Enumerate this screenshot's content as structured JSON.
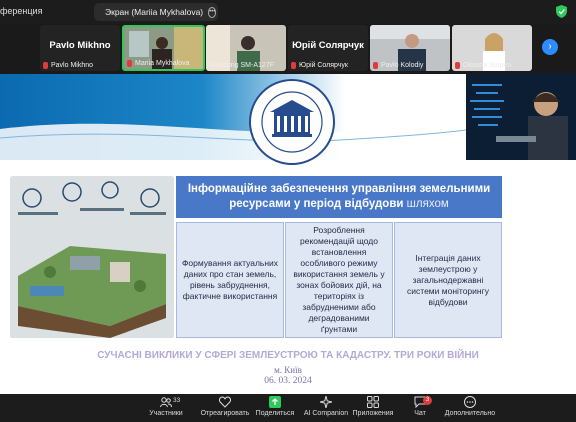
{
  "topbar": {
    "app_title": "ференция",
    "share_label": "Экран (Mariia Mykhalova)"
  },
  "gallery": {
    "tiles": [
      {
        "big_name": "Pavlo Mikhno",
        "caption": "Pavlo Mikhno"
      },
      {
        "big_name": "",
        "caption": "Mariia Mykhalova"
      },
      {
        "big_name": "",
        "caption": "Samsung SM-A127F"
      },
      {
        "big_name": "Юрій Солярчук",
        "caption": "Юрій Солярчук"
      },
      {
        "big_name": "",
        "caption": "Pavlo Kolodiy"
      },
      {
        "big_name": "",
        "caption": "Oksana Stupen"
      }
    ],
    "next_icon": "chevron-right-icon"
  },
  "slide": {
    "title_main": "Інформаційне забезпечення управління земельними ресурсами у період відбудови",
    "title_tail": "шляхом",
    "cells": [
      "Формування актуальних даних про стан земель, рівень забруднення, фактичне використання",
      "Розроблення рекомендацій щодо встановлення особливого режиму використання земель у зонах бойових дій, на територіях із забрудненими або деградованими ґрунтами",
      "Інтеграція даних землеустрою у загальнодержавні системи моніторингу відбудови"
    ],
    "bottom_line": "СУЧАСНІ ВИКЛИКИ У СФЕРІ ЗЕМЛЕУСТРОЮ ТА КАДАСТРУ. ТРИ РОКИ ВІЙНИ",
    "city": "м. Київ",
    "date": "06. 03. 2024"
  },
  "toolbar": {
    "participants_label": "Участники",
    "participants_count": "33",
    "react_label": "Отреагировать",
    "share_label": "Поделиться",
    "ai_label": "AI Companion",
    "apps_label": "Приложения",
    "chat_label": "Чат",
    "chat_badge": "3",
    "more_label": "Дополнительно"
  },
  "colors": {
    "accent_blue": "#2d8cff",
    "share_green": "#2fc95b",
    "title_box": "#4a78c8",
    "muted_red": "#e03b3b"
  }
}
